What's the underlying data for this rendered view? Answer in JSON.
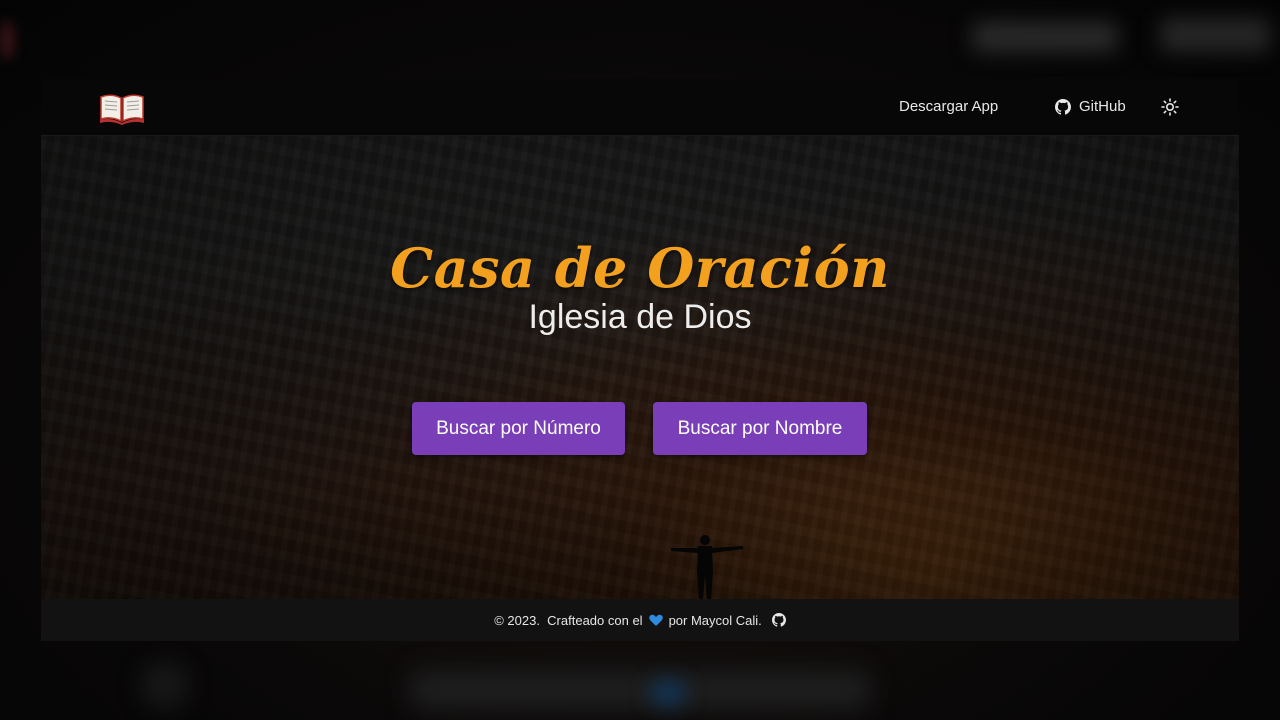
{
  "navbar": {
    "logo_icon": "open-book-icon",
    "download_label": "Descargar App",
    "github_label": "GitHub",
    "theme_icon": "sun-icon"
  },
  "hero": {
    "title": "Casa de Oración",
    "subtitle": "Iglesia de Dios",
    "buttons": {
      "by_number": "Buscar por Número",
      "by_name": "Buscar por Nombre"
    }
  },
  "footer": {
    "copyright": "© 2023.",
    "crafted_prefix": "Crafteado con el",
    "crafted_suffix": "por Maycol Cali.",
    "heart_icon": "heart-icon",
    "github_icon": "github-icon"
  },
  "colors": {
    "title": "#f2a01e",
    "button": "#7a3fb8",
    "heart": "#2f8be0"
  }
}
